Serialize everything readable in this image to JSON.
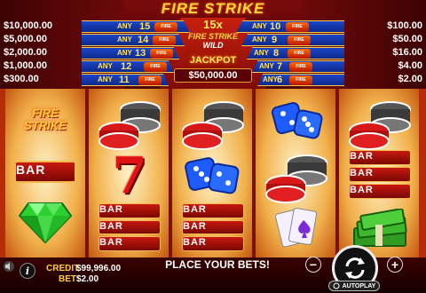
{
  "paytable": {
    "left": [
      {
        "amount": "$10,000.00",
        "any": "ANY",
        "count": "15"
      },
      {
        "amount": "$5,000.00",
        "any": "ANY",
        "count": "14"
      },
      {
        "amount": "$2,000.00",
        "any": "ANY",
        "count": "13"
      },
      {
        "amount": "$1,000.00",
        "any": "ANY",
        "count": "12"
      },
      {
        "amount": "$300.00",
        "any": "ANY",
        "count": "11"
      }
    ],
    "right": [
      {
        "amount": "$100.00",
        "any": "ANY",
        "count": "10"
      },
      {
        "amount": "$50.00",
        "any": "ANY",
        "count": "9"
      },
      {
        "amount": "$16.00",
        "any": "ANY",
        "count": "8"
      },
      {
        "amount": "$4.00",
        "any": "ANY",
        "count": "7"
      },
      {
        "amount": "$2.00",
        "any": "ANY",
        "count": "6"
      }
    ],
    "multiplier": "15x",
    "wild_logo_line1": "FIRE STRIKE",
    "wild_logo_line2": "WILD",
    "jackpot_label": "JACKPOT",
    "jackpot_value": "$50,000.00",
    "mini_logo": "FIRE STRIKE"
  },
  "title": "FIRE STRIKE",
  "reels": {
    "bar": "BAR",
    "fire_logo_line1": "FIRE",
    "fire_logo_line2": "STRIKE"
  },
  "bottom": {
    "credit_label": "CREDIT",
    "credit_value": "$99,996.00",
    "bet_label": "BET",
    "bet_value": "$2.00",
    "message": "PLACE YOUR BETS!",
    "minus": "−",
    "plus": "+",
    "autoplay": "AUTOPLAY",
    "info": "i"
  },
  "colors": {
    "accent": "#ffdb3a",
    "band": "#1c45c9",
    "bar": "#c81810"
  }
}
